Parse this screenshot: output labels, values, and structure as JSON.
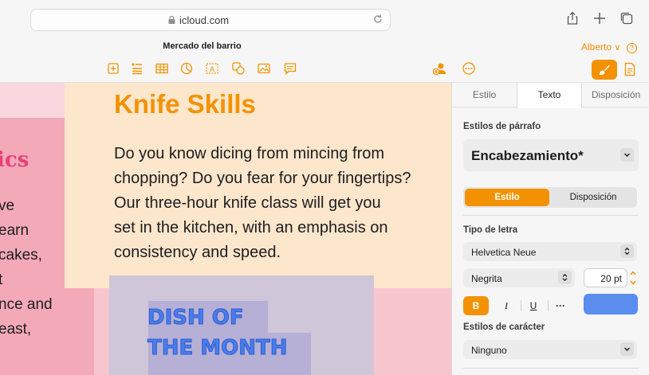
{
  "browser": {
    "url": "icloud.com"
  },
  "app": {
    "document_title": "Mercado del barrio",
    "user_name": "Alberto",
    "user_chevron": "∨",
    "help_glyph": "?",
    "accent_color": "#f39200"
  },
  "toolbar": {
    "icons": [
      "add-page-icon",
      "bulleted-list-icon",
      "table-icon",
      "chart-icon",
      "text-box-icon",
      "shape-icon",
      "media-icon",
      "comment-icon",
      "collaborate-icon",
      "more-icon",
      "format-brush-icon",
      "document-icon"
    ]
  },
  "canvas": {
    "left_block": {
      "title_fragment": "ics",
      "lines": [
        "ve",
        "earn",
        "cakes,",
        "t",
        "nce and",
        "east,"
      ]
    },
    "main_block": {
      "title": "Knife Skills",
      "lines": [
        "Do you know dicing from mincing from",
        "chopping? Do you fear for your fingertips?",
        "Our three-hour knife class will get you",
        "set in the kitchen, with an emphasis on",
        "consistency and speed."
      ]
    },
    "dish_block": {
      "lines": [
        "DISH OF",
        "THE MONTH"
      ]
    }
  },
  "sidebar": {
    "tabs": [
      {
        "label": "Estilo",
        "active": false
      },
      {
        "label": "Texto",
        "active": true
      },
      {
        "label": "Disposición",
        "active": false
      }
    ],
    "paragraph_styles_label": "Estilos de párrafo",
    "paragraph_style_value": "Encabezamiento*",
    "segments": {
      "on": "Estilo",
      "off": "Disposición"
    },
    "font_label": "Tipo de letra",
    "font_family": "Helvetica Neue",
    "font_weight": "Negrita",
    "font_size": "20 pt",
    "format_buttons": {
      "bold": "B",
      "italic": "I",
      "underline": "U",
      "more": "···"
    },
    "text_color": "#5b8def",
    "char_styles_label": "Estilos de carácter",
    "char_style_value": "Ninguno"
  }
}
